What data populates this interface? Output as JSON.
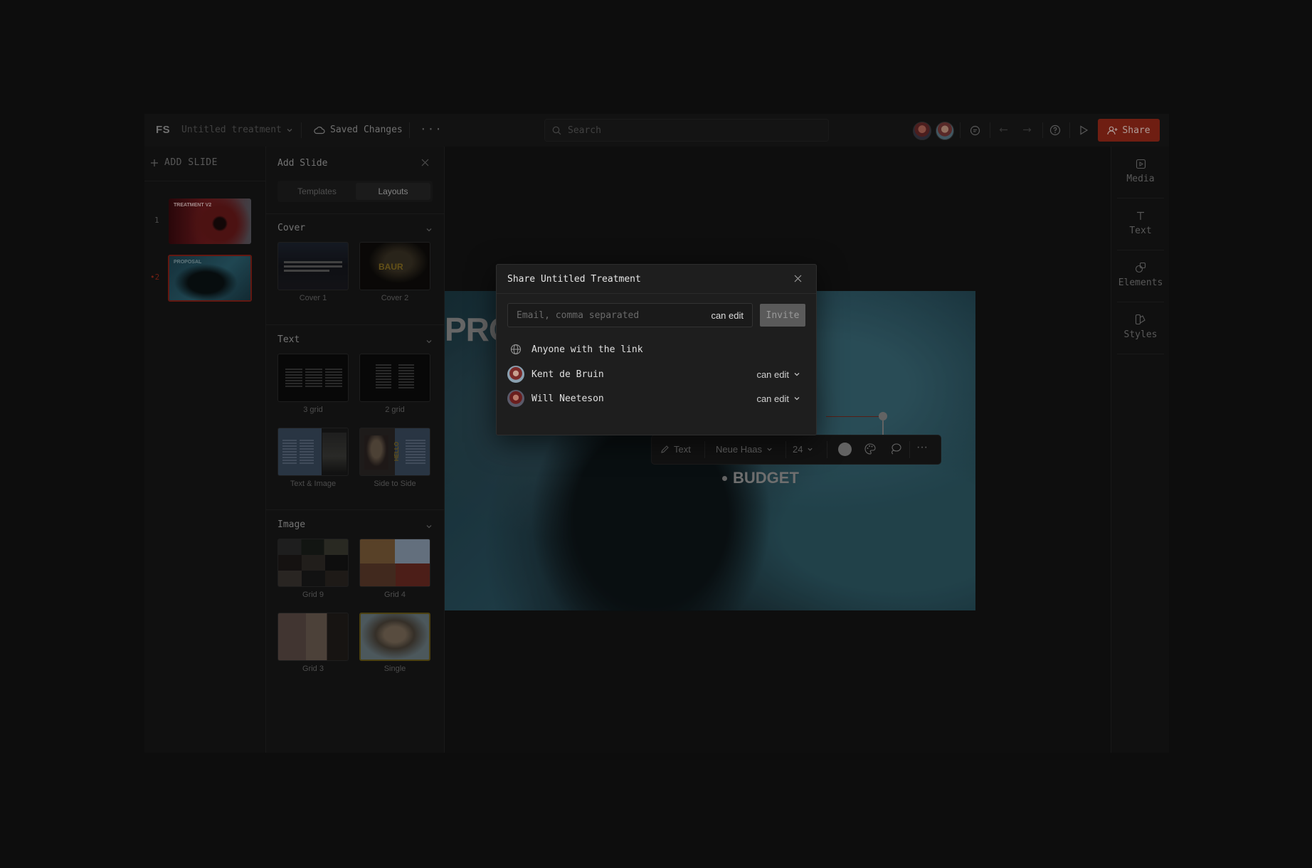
{
  "topbar": {
    "logo": "FS",
    "doc_title": "Untitled treatment",
    "saved_label": "Saved Changes",
    "more_label": "···",
    "search_placeholder": "Search",
    "share_label": "Share"
  },
  "slides": {
    "add_label": "ADD SLIDE",
    "items": [
      {
        "number": "1",
        "thumb_title": "TREATMENT V2"
      },
      {
        "number": "2",
        "thumb_title": "PROPOSAL"
      }
    ]
  },
  "panel": {
    "title": "Add Slide",
    "tabs": [
      "Templates",
      "Layouts"
    ],
    "active_tab": "Layouts",
    "sections": [
      {
        "title": "Cover",
        "layouts": [
          "Cover 1",
          "Cover 2"
        ]
      },
      {
        "title": "Text",
        "layouts": [
          "3 grid",
          "2 grid",
          "Text & Image",
          "Side to Side"
        ]
      },
      {
        "title": "Image",
        "layouts": [
          "Grid 9",
          "Grid 4",
          "Grid 3",
          "Single"
        ]
      }
    ],
    "cover2_word": "BAUR",
    "side_word": "HELLO"
  },
  "canvas": {
    "partial_heading": "PRO",
    "budget_label": "BUDGET",
    "toolbar": {
      "text_label": "Text",
      "font": "Neue Haas",
      "size": "24",
      "more": "···"
    }
  },
  "rail": {
    "items": [
      "Media",
      "Text",
      "Elements",
      "Styles"
    ]
  },
  "share_modal": {
    "title": "Share Untitled Treatment",
    "email_placeholder": "Email, comma separated",
    "email_permission": "can edit",
    "invite_label": "Invite",
    "link_label": "Anyone with the link",
    "members": [
      {
        "name": "Kent de Bruin",
        "permission": "can edit"
      },
      {
        "name": "Will Neeteson",
        "permission": "can edit"
      }
    ]
  },
  "colors": {
    "accent": "#9a2a1a",
    "selection": "#7a2a1e",
    "background": "#121212"
  }
}
